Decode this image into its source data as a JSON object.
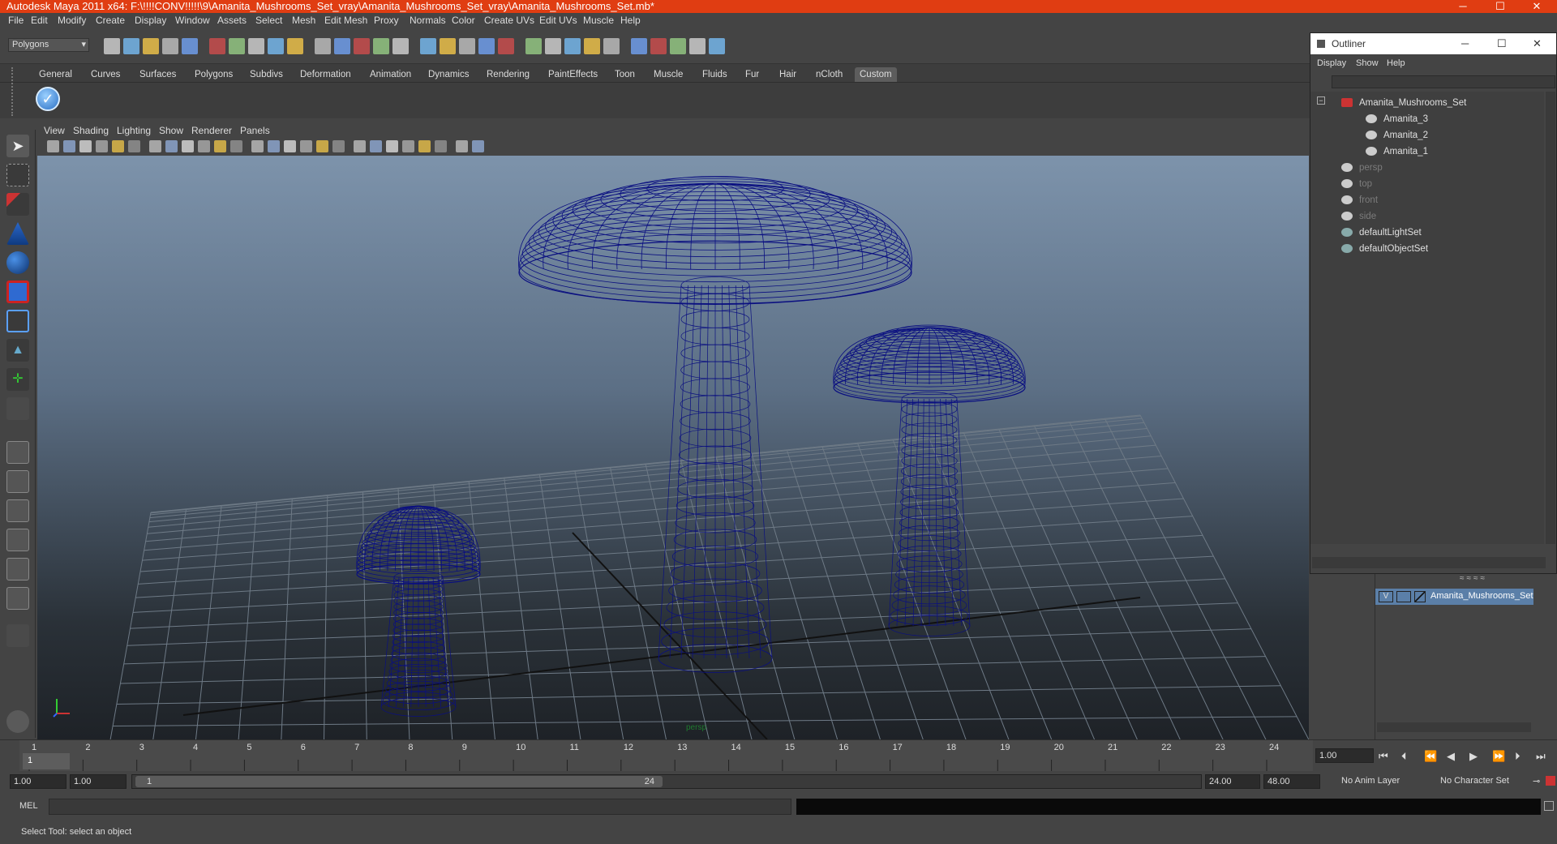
{
  "window": {
    "title": "Autodesk Maya 2011 x64: F:\\!!!!CONV!!!!!\\9\\Amanita_Mushrooms_Set_vray\\Amanita_Mushrooms_Set_vray\\Amanita_Mushrooms_Set.mb*",
    "minimize": "─",
    "maximize": "☐",
    "close": "✕"
  },
  "menubar": [
    "File",
    "Edit",
    "Modify",
    "Create",
    "Display",
    "Window",
    "Assets",
    "Select",
    "Mesh",
    "Edit Mesh",
    "Proxy",
    "Normals",
    "Color",
    "Create UVs",
    "Edit UVs",
    "Muscle",
    "Help"
  ],
  "statusline": {
    "menuset": "Polygons"
  },
  "shelf": {
    "tabs": [
      "General",
      "Curves",
      "Surfaces",
      "Polygons",
      "Subdivs",
      "Deformation",
      "Animation",
      "Dynamics",
      "Rendering",
      "PaintEffects",
      "Toon",
      "Muscle",
      "Fluids",
      "Fur",
      "Hair",
      "nCloth",
      "Custom"
    ],
    "active_tab": "Custom"
  },
  "panel": {
    "menu": [
      "View",
      "Shading",
      "Lighting",
      "Show",
      "Renderer",
      "Panels"
    ]
  },
  "viewport": {
    "camera_label": "persp"
  },
  "timeline": {
    "ticks": [
      "1",
      "2",
      "3",
      "4",
      "5",
      "6",
      "7",
      "8",
      "9",
      "10",
      "11",
      "12",
      "13",
      "14",
      "15",
      "16",
      "17",
      "18",
      "19",
      "20",
      "21",
      "22",
      "23",
      "24"
    ],
    "current_frame": "1",
    "current_time_field": "1.00"
  },
  "range": {
    "start_time": "1.00",
    "start_playback": "1.00",
    "slider_start": "1",
    "slider_end": "24",
    "end_playback": "24.00",
    "end_time": "48.00",
    "anim_layer": "No Anim Layer",
    "character_set": "No Character Set"
  },
  "cmdline": {
    "label": "MEL"
  },
  "helpline": {
    "text": "Select Tool: select an object"
  },
  "outliner": {
    "title": "Outliner",
    "menu": [
      "Display",
      "Show",
      "Help"
    ],
    "items": [
      {
        "label": "Amanita_Mushrooms_Set",
        "dim": false
      },
      {
        "label": "Amanita_3",
        "dim": false
      },
      {
        "label": "Amanita_2",
        "dim": false
      },
      {
        "label": "Amanita_1",
        "dim": false
      },
      {
        "label": "persp",
        "dim": true
      },
      {
        "label": "top",
        "dim": true
      },
      {
        "label": "front",
        "dim": true
      },
      {
        "label": "side",
        "dim": true
      },
      {
        "label": "defaultLightSet",
        "dim": false
      },
      {
        "label": "defaultObjectSet",
        "dim": false
      }
    ]
  },
  "layers": {
    "layer_name": "Amanita_Mushrooms_Set",
    "visible_flag": "V"
  },
  "colors": {
    "titlebar": "#e03d12",
    "wireframe": "#0a0f80",
    "active_tab": "#5d5d5d",
    "selected_layer": "#5b7fa8"
  }
}
